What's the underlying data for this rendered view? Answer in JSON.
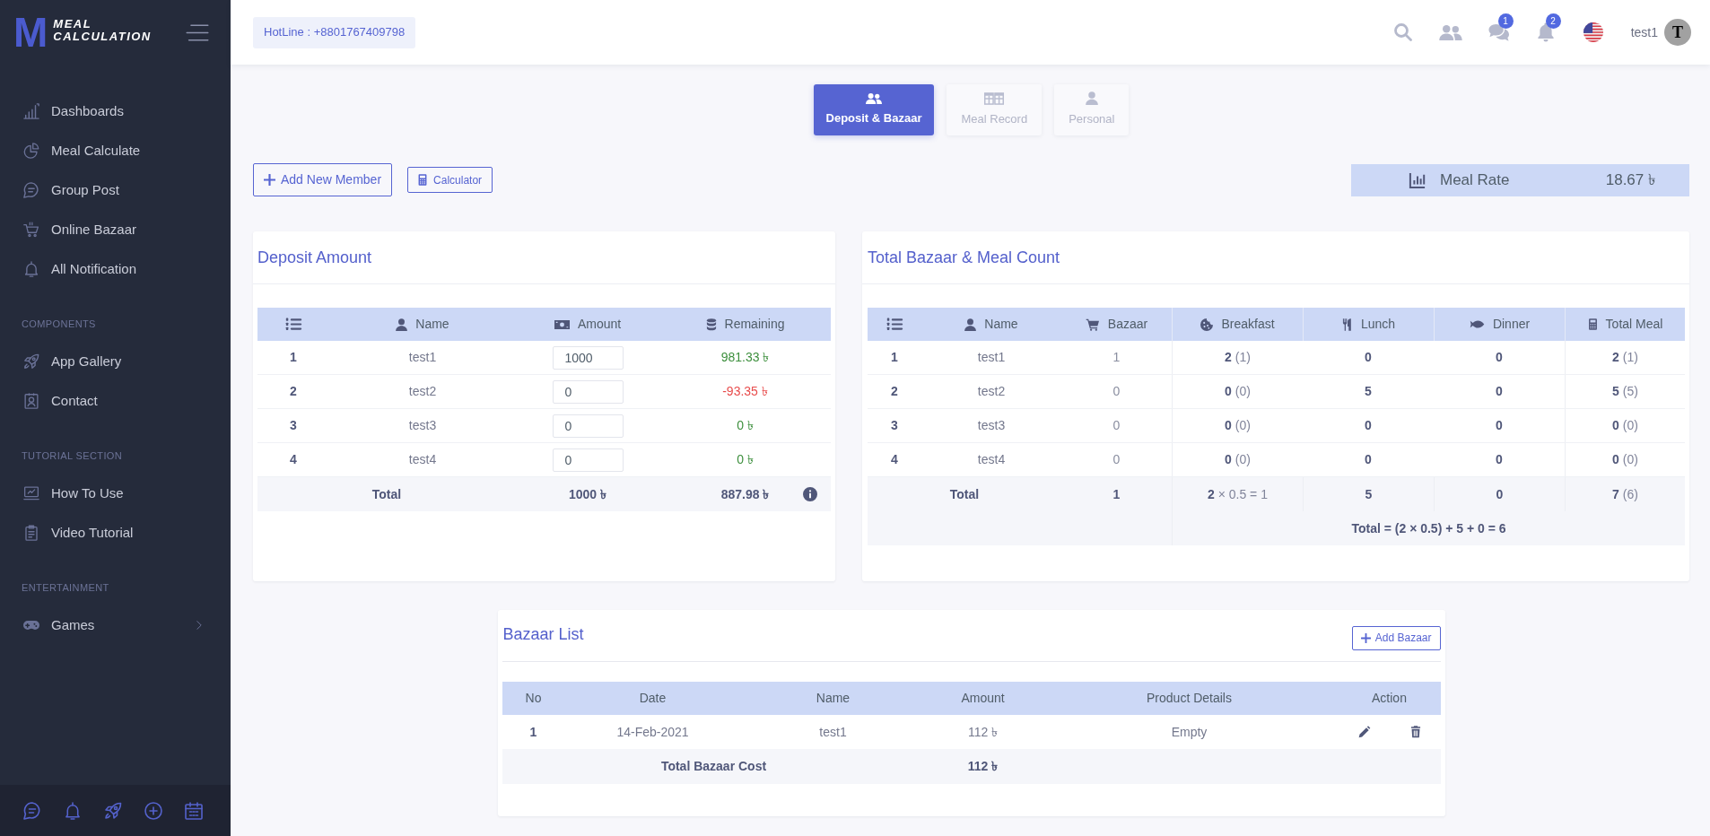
{
  "sidebar": {
    "logo": {
      "letter": "M",
      "lines": [
        "MEAL",
        "CALCULATION"
      ]
    },
    "sections": [
      {
        "items": [
          {
            "kind": "link",
            "label": "Dashboards",
            "selected": false
          },
          {
            "kind": "link",
            "label": "Meal Calculate",
            "selected": false
          },
          {
            "kind": "link",
            "label": "Group Post",
            "selected": false
          },
          {
            "kind": "link",
            "label": "Online Bazaar",
            "selected": false
          },
          {
            "kind": "link",
            "label": "All Notification",
            "selected": false
          }
        ]
      },
      {
        "heading": "COMPONENTS",
        "items": [
          {
            "kind": "link",
            "label": "App Gallery",
            "selected": false
          },
          {
            "kind": "link",
            "label": "Contact",
            "selected": false
          }
        ]
      },
      {
        "heading": "TUTORIAL SECTION",
        "items": [
          {
            "kind": "link",
            "label": "How To Use",
            "selected": false
          },
          {
            "kind": "link",
            "label": "Video Tutorial",
            "selected": false
          }
        ]
      },
      {
        "heading": "ENTERTAINMENT",
        "items": [
          {
            "kind": "submenu",
            "label": "Games",
            "selected": false
          }
        ]
      }
    ]
  },
  "header": {
    "hotline": "HotLine : +8801767409798",
    "message_count": "1",
    "notification_count": "2",
    "user": {
      "name": "test1",
      "initial": "T"
    }
  },
  "tabs": [
    {
      "label": "Deposit & Bazaar",
      "selected": true
    },
    {
      "label": "Meal Record",
      "selected": false
    },
    {
      "label": "Personal",
      "selected": false
    }
  ],
  "toolbar": {
    "add_member": "Add New Member",
    "calculator": "Calculator",
    "meal_rate": {
      "label": "Meal Rate",
      "value": "18.67 ৳"
    }
  },
  "deposit": {
    "title": "Deposit Amount",
    "columns": [
      "Name",
      "Amount",
      "Remaining"
    ],
    "rows": [
      {
        "no": "1",
        "name": "test1",
        "amount": "1000",
        "remaining": "981.33 ৳",
        "color": "#3d8f3d"
      },
      {
        "no": "2",
        "name": "test2",
        "amount": "0",
        "remaining": "-93.35 ৳",
        "color": "#e84c4c"
      },
      {
        "no": "3",
        "name": "test3",
        "amount": "0",
        "remaining": "0 ৳",
        "color": "#3d8f3d"
      },
      {
        "no": "4",
        "name": "test4",
        "amount": "0",
        "remaining": "0 ৳",
        "color": "#3d8f3d"
      }
    ],
    "total": {
      "label": "Total",
      "amount": "1000 ৳",
      "remaining": "887.98 ৳"
    }
  },
  "meal_count": {
    "title": "Total Bazaar & Meal Count",
    "columns": [
      "Name",
      "Bazaar",
      "Breakfast",
      "Lunch",
      "Dinner",
      "Total Meal"
    ],
    "rows": [
      {
        "no": "1",
        "name": "test1",
        "bazaar": "1",
        "breakfast": "**2** (1)",
        "lunch": "0",
        "dinner": "0",
        "total_meal": "**2** (1)"
      },
      {
        "no": "2",
        "name": "test2",
        "bazaar": "0",
        "breakfast": "**0** (0)",
        "lunch": "5",
        "dinner": "0",
        "total_meal": "**5** (5)"
      },
      {
        "no": "3",
        "name": "test3",
        "bazaar": "0",
        "breakfast": "**0** (0)",
        "lunch": "0",
        "dinner": "0",
        "total_meal": "**0** (0)"
      },
      {
        "no": "4",
        "name": "test4",
        "bazaar": "0",
        "breakfast": "**0** (0)",
        "lunch": "0",
        "dinner": "0",
        "total_meal": "**0** (0)"
      }
    ],
    "total": {
      "label": "Total",
      "bazaar": "1",
      "breakfast": "**2** × 0.5 = 1",
      "lunch": "5",
      "dinner": "0",
      "total_meal": "**7** (6)"
    },
    "formula": "Total = (2 × 0.5) + 5 + 0 = 6"
  },
  "bazaar_list": {
    "title": "Bazaar List",
    "add_button": "Add Bazaar",
    "columns": [
      "No",
      "Date",
      "Name",
      "Amount",
      "Product Details",
      "Action"
    ],
    "rows": [
      {
        "no": "1",
        "date": "14-Feb-2021",
        "name": "test1",
        "amount": "112 ৳",
        "details": "Empty"
      }
    ],
    "total": {
      "label": "Total Bazaar Cost",
      "amount": "112 ৳"
    }
  }
}
